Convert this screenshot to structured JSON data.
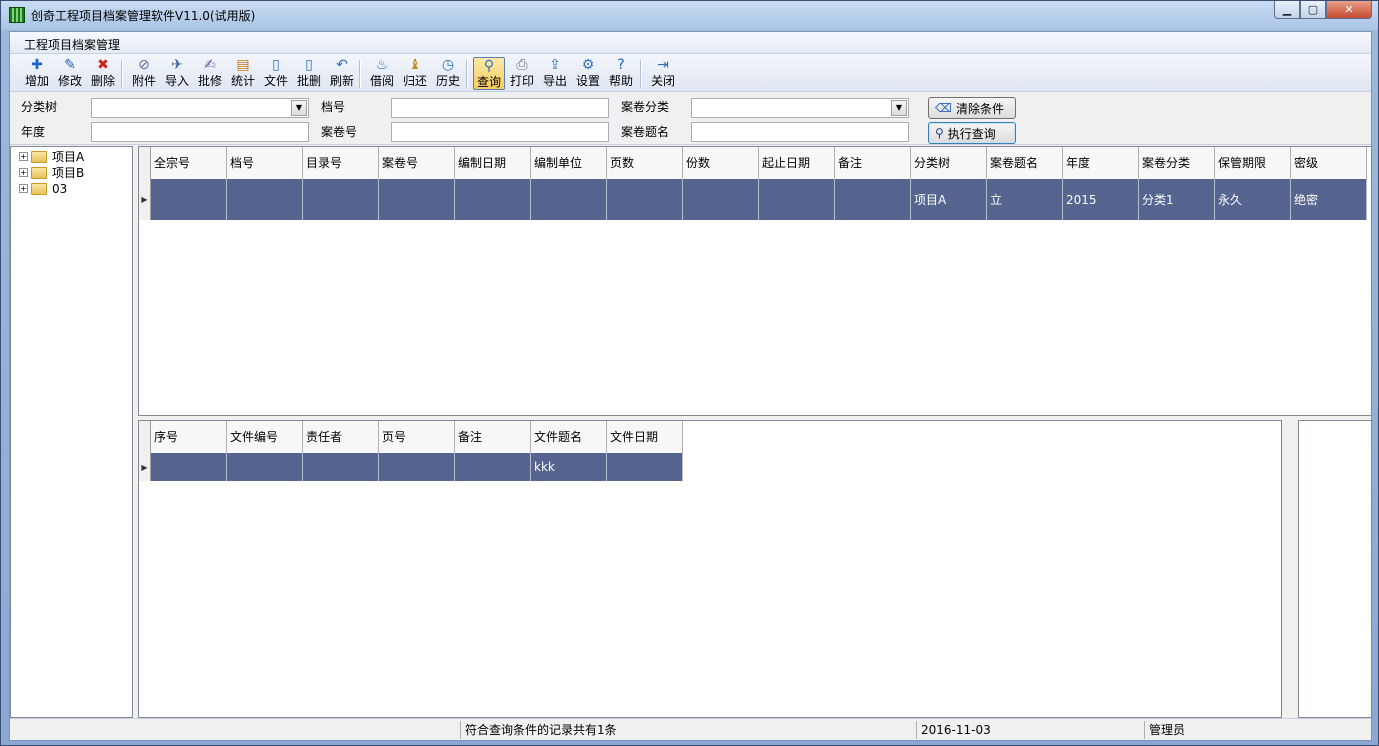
{
  "window": {
    "title": "创奇工程项目档案管理软件V11.0(试用版)"
  },
  "menu": {
    "items": [
      "工程项目档案管理"
    ]
  },
  "toolbar": {
    "buttons": [
      {
        "label": "增加",
        "icon": "plus-icon",
        "color": "#1e63c8"
      },
      {
        "label": "修改",
        "icon": "pencil-icon",
        "color": "#2c5fb0"
      },
      {
        "label": "删除",
        "icon": "x-icon",
        "color": "#d0221b"
      },
      {
        "label": "附件",
        "icon": "paperclip-icon",
        "color": "#5a6f9b"
      },
      {
        "label": "导入",
        "icon": "import-icon",
        "color": "#3d5c94"
      },
      {
        "label": "批修",
        "icon": "batch-edit-icon",
        "color": "#6b5aa8"
      },
      {
        "label": "统计",
        "icon": "clipboard-icon",
        "color": "#c27a1d"
      },
      {
        "label": "文件",
        "icon": "document-icon",
        "color": "#2f6fc0"
      },
      {
        "label": "批删",
        "icon": "batch-delete-icon",
        "color": "#2f6fc0"
      },
      {
        "label": "刷新",
        "icon": "refresh-icon",
        "color": "#2f6fc0"
      },
      {
        "label": "借阅",
        "icon": "borrow-icon",
        "color": "#2f6fc0"
      },
      {
        "label": "归还",
        "icon": "return-icon",
        "color": "#c08a1d"
      },
      {
        "label": "历史",
        "icon": "clock-icon",
        "color": "#2f6fc0"
      },
      {
        "label": "查询",
        "icon": "magnifier-icon",
        "color": "#2f6fc0"
      },
      {
        "label": "打印",
        "icon": "printer-icon",
        "color": "#707070"
      },
      {
        "label": "导出",
        "icon": "export-icon",
        "color": "#2f6fc0"
      },
      {
        "label": "设置",
        "icon": "gear-icon",
        "color": "#2f6fc0"
      },
      {
        "label": "帮助",
        "icon": "help-icon",
        "color": "#1e63c8"
      },
      {
        "label": "关闭",
        "icon": "exit-icon",
        "color": "#2f6fc0"
      }
    ],
    "active": "查询"
  },
  "filters": {
    "category_tree_label": "分类树",
    "year_label": "年度",
    "archive_no_label": "档号",
    "volume_no_label": "案卷号",
    "volume_category_label": "案卷分类",
    "volume_title_label": "案卷题名",
    "clear_button": "清除条件",
    "run_button": "执行查询"
  },
  "tree": {
    "nodes": [
      "项目A",
      "项目B",
      "03"
    ]
  },
  "volumes": {
    "columns": [
      "全宗号",
      "档号",
      "目录号",
      "案卷号",
      "编制日期",
      "编制单位",
      "页数",
      "份数",
      "起止日期",
      "备注",
      "分类树",
      "案卷题名",
      "年度",
      "案卷分类",
      "保管期限",
      "密级"
    ],
    "rows": [
      [
        "",
        "",
        "",
        "",
        "",
        "",
        "",
        "",
        "",
        "",
        "项目A",
        "立",
        "2015",
        "分类1",
        "永久",
        "绝密"
      ]
    ]
  },
  "files": {
    "columns": [
      "序号",
      "文件编号",
      "责任者",
      "页号",
      "备注",
      "文件题名",
      "文件日期"
    ],
    "rows": [
      [
        "",
        "",
        "",
        "",
        "",
        "kkk",
        ""
      ]
    ]
  },
  "status": {
    "message": "符合查询条件的记录共有1条",
    "date": "2016-11-03",
    "user": "管理员"
  },
  "colors": {
    "selected_row": "#56658f",
    "accent": "#1e63c8"
  }
}
